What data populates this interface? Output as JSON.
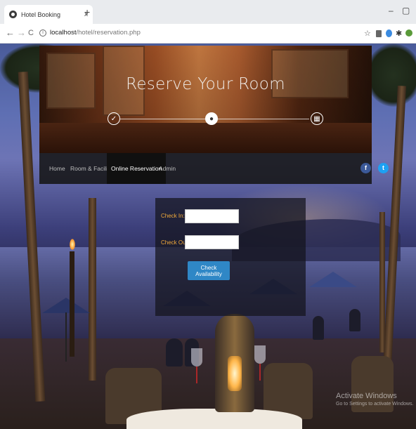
{
  "browser": {
    "tab_title": "Hotel Booking",
    "tab_close": "x",
    "new_tab": "+",
    "minimize": "–",
    "restore": "▢",
    "back": "←",
    "forward": "→",
    "reload": "C",
    "url_host": "localhost",
    "url_path": "/hotel/reservation.php",
    "star": "☆"
  },
  "banner": {
    "title": "Reserve Your Room",
    "steps": [
      {
        "icon": "check-icon",
        "glyph": "✓"
      },
      {
        "icon": "user-icon",
        "glyph": "●"
      },
      {
        "icon": "calendar-icon",
        "glyph": "▦"
      }
    ]
  },
  "nav": {
    "items": [
      {
        "label": "Home",
        "active": false
      },
      {
        "label": "Room & Facilities",
        "active": false
      },
      {
        "label": "Online Reservation",
        "active": true
      },
      {
        "label": "Admin",
        "active": false
      }
    ],
    "facebook": "f",
    "twitter": "t"
  },
  "form": {
    "check_in_label": "Check In:",
    "check_in_value": "",
    "check_out_label": "Check Out:",
    "check_out_value": "",
    "button_label": "Check Availability"
  },
  "watermark": {
    "line1": "Activate Windows",
    "line2": "Go to Settings to activate Windows."
  },
  "colors": {
    "accent_label": "#f0a93a",
    "button": "#2f87c6",
    "facebook": "#3b5998",
    "twitter": "#1da1f2"
  }
}
